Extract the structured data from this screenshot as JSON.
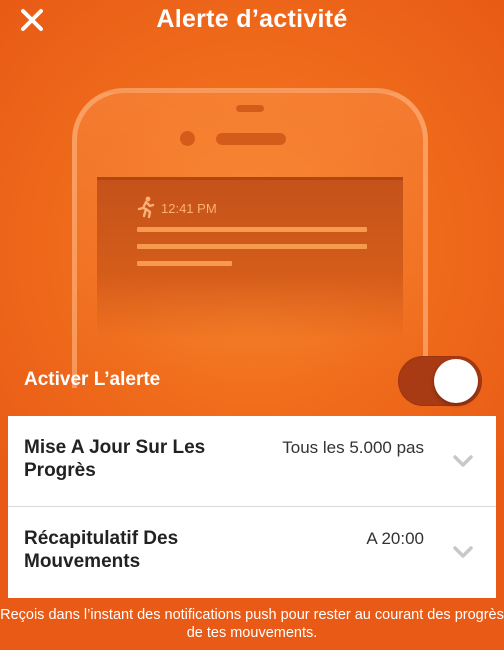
{
  "header": {
    "title": "Alerte d’activité",
    "close_icon": "close-icon"
  },
  "illustration": {
    "notification_icon": "running-person-icon",
    "notification_time": "12:41 PM"
  },
  "alert_toggle": {
    "label": "Activer L’alerte",
    "enabled": true
  },
  "settings": {
    "rows": [
      {
        "title": "Mise A Jour Sur Les Progrès",
        "value": "Tous les 5.000 pas",
        "icon": "chevron-down-icon"
      },
      {
        "title": "Récapitulatif Des Mouvements",
        "value": "A 20:00",
        "icon": "chevron-down-icon"
      }
    ]
  },
  "footer": {
    "text": "Reçois dans l’instant des notifications push pour rester au courant des progrès de tes mouvements."
  },
  "colors": {
    "background": "#f06d1c",
    "toggle_on": "#a83a14",
    "card": "#ffffff"
  }
}
